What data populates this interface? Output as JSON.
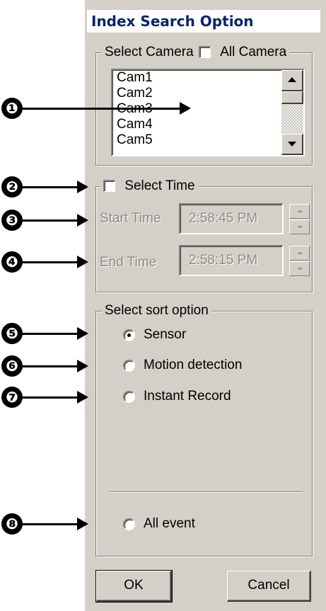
{
  "dialog": {
    "title": "Index Search Option"
  },
  "camera": {
    "group_label": "Select Camera",
    "all_camera_label": "All Camera",
    "all_camera_checked": false,
    "items": [
      "Cam1",
      "Cam2",
      "Cam3",
      "Cam4",
      "Cam5"
    ]
  },
  "time": {
    "select_time_label": "Select Time",
    "select_time_checked": false,
    "start_label": "Start Time",
    "start_value": "2:58:45 PM",
    "end_label": "End Time",
    "end_value": "2:58:15 PM"
  },
  "sort": {
    "group_label": "Select sort option",
    "options": [
      {
        "label": "Sensor",
        "checked": true
      },
      {
        "label": "Motion detection",
        "checked": false
      },
      {
        "label": "Instant Record",
        "checked": false
      }
    ],
    "all_event_label": "All event"
  },
  "buttons": {
    "ok": "OK",
    "cancel": "Cancel"
  },
  "callouts": [
    "❶",
    "❷",
    "❸",
    "❹",
    "❺",
    "❻",
    "❼",
    "❽"
  ],
  "icons": {
    "scroll_up": "triangle-up-icon",
    "scroll_down": "triangle-down-icon",
    "spin_up": "spin-up-icon",
    "spin_down": "spin-down-icon"
  },
  "colors": {
    "panel_bg": "#d4d0c8",
    "title_text": "#0a246a",
    "disabled_text": "#8e8b85"
  }
}
